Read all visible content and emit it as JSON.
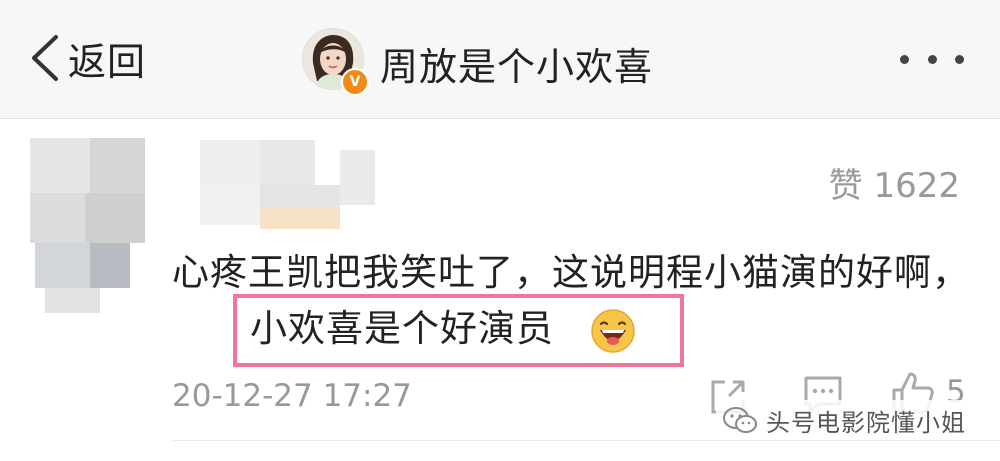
{
  "nav": {
    "back_label": "返回",
    "title": "周放是个小欢喜",
    "verified_badge": "V"
  },
  "comment": {
    "likes": "赞 1622",
    "text": "心疼王凯把我笑吐了，这说明程小猫演的好啊，",
    "highlight": "小欢喜是个好演员",
    "emoji": "grinning-face-emoji",
    "timestamp": "20-12-27 17:27",
    "like_count": "5"
  },
  "watermark": {
    "text": "头号电影院懂小姐",
    "icon": "wechat-icon"
  },
  "colors": {
    "highlight_border": "#f0759b",
    "badge": "#f08b1a",
    "muted_text": "#999999"
  }
}
